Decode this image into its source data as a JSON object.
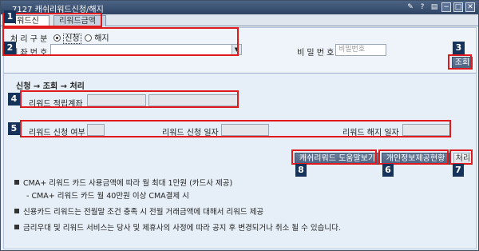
{
  "window": {
    "title": "7127 캐쉬리워드신청/해지",
    "controls": [
      "pin-icon",
      "help-icon",
      "menu-icon",
      "minimize-icon",
      "maximize-icon",
      "close-icon"
    ]
  },
  "tabs": [
    {
      "label": "리워드신청",
      "active": true
    },
    {
      "label": "리워드금액",
      "active": false
    }
  ],
  "form": {
    "process_label": "처 리 구 분",
    "radio_apply": "신청",
    "radio_cancel": "해지",
    "account_label": "계 좌 번 호",
    "account_value": "",
    "password_label": "비 밀 번 호",
    "password_placeholder": "비밀번호",
    "query_button": "조회"
  },
  "flow": {
    "heading": "신청 → 조회 → 처리",
    "reward_account_label": "리워드 적립계좌",
    "apply_status_label": "리워드 신청 여부",
    "apply_date_label": "리워드 신청 일자",
    "cancel_date_label": "리워드 해지 일자"
  },
  "buttons": {
    "help": "캐쉬리워드 도움말보기",
    "privacy": "개인정보제공현황",
    "process": "처리"
  },
  "badges": [
    "1",
    "2",
    "3",
    "4",
    "5",
    "6",
    "7",
    "8"
  ],
  "notes": [
    "CMA+ 리워드 카드 사용금액에 따라 월 최대 1만원 (카드사 제공)",
    "- CMA+ 리워드 카드 월 40만원 이상 CMA결제 시",
    "신용카드 리워드는 전월말 조건 충족 시 전월 거래금액에 대해서 리워드 제공",
    "금리우대 및 리워드 서비스는 당사 및 제휴사의 사정에 따라 공지 후 변경되거나 취소 될 수 있습니다."
  ],
  "colors": {
    "highlight": "#e0191d",
    "badge": "#14325a",
    "titlebar": "#2f4463",
    "panel": "#e6eff7"
  }
}
